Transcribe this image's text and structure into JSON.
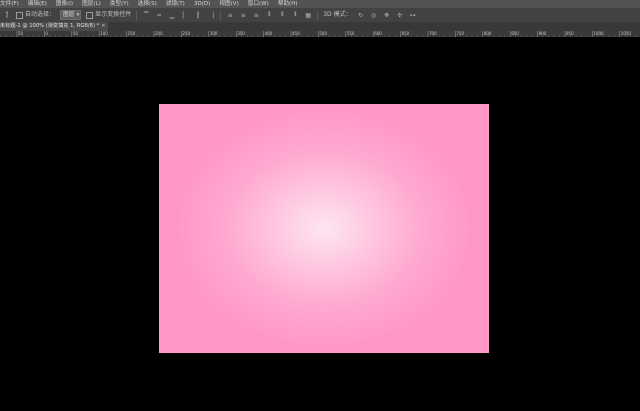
{
  "menubar": {
    "items": [
      "文件(F)",
      "编辑(E)",
      "图像(I)",
      "图层(L)",
      "类型(Y)",
      "选择(S)",
      "滤镜(T)",
      "3D(D)",
      "视图(V)",
      "窗口(W)",
      "帮助(H)"
    ]
  },
  "options": {
    "auto_select_label": "自动选择：",
    "auto_select_value": "图层",
    "transform_label": "显示变换控件",
    "mode_3d_label": "3D 模式："
  },
  "document": {
    "tab_title": "未标题-1 @ 100% (渐变填充 1, RGB/8) *",
    "close_glyph": "×",
    "colors": {
      "center": "#fde6f1",
      "edge": "#ff97c8"
    }
  },
  "ruler": {
    "labels": [
      "50",
      "0",
      "50",
      "100",
      "150",
      "200",
      "250",
      "300",
      "350",
      "400",
      "450",
      "500",
      "550",
      "600",
      "650",
      "700",
      "750",
      "800",
      "850",
      "900",
      "950",
      "1000",
      "1050"
    ]
  },
  "icons": [
    "move-tool-icon",
    "align-icons",
    "distribute-icons",
    "3d-rotate-icon",
    "3d-roll-icon",
    "3d-pan-icon",
    "3d-slide-icon",
    "3d-scale-icon"
  ]
}
